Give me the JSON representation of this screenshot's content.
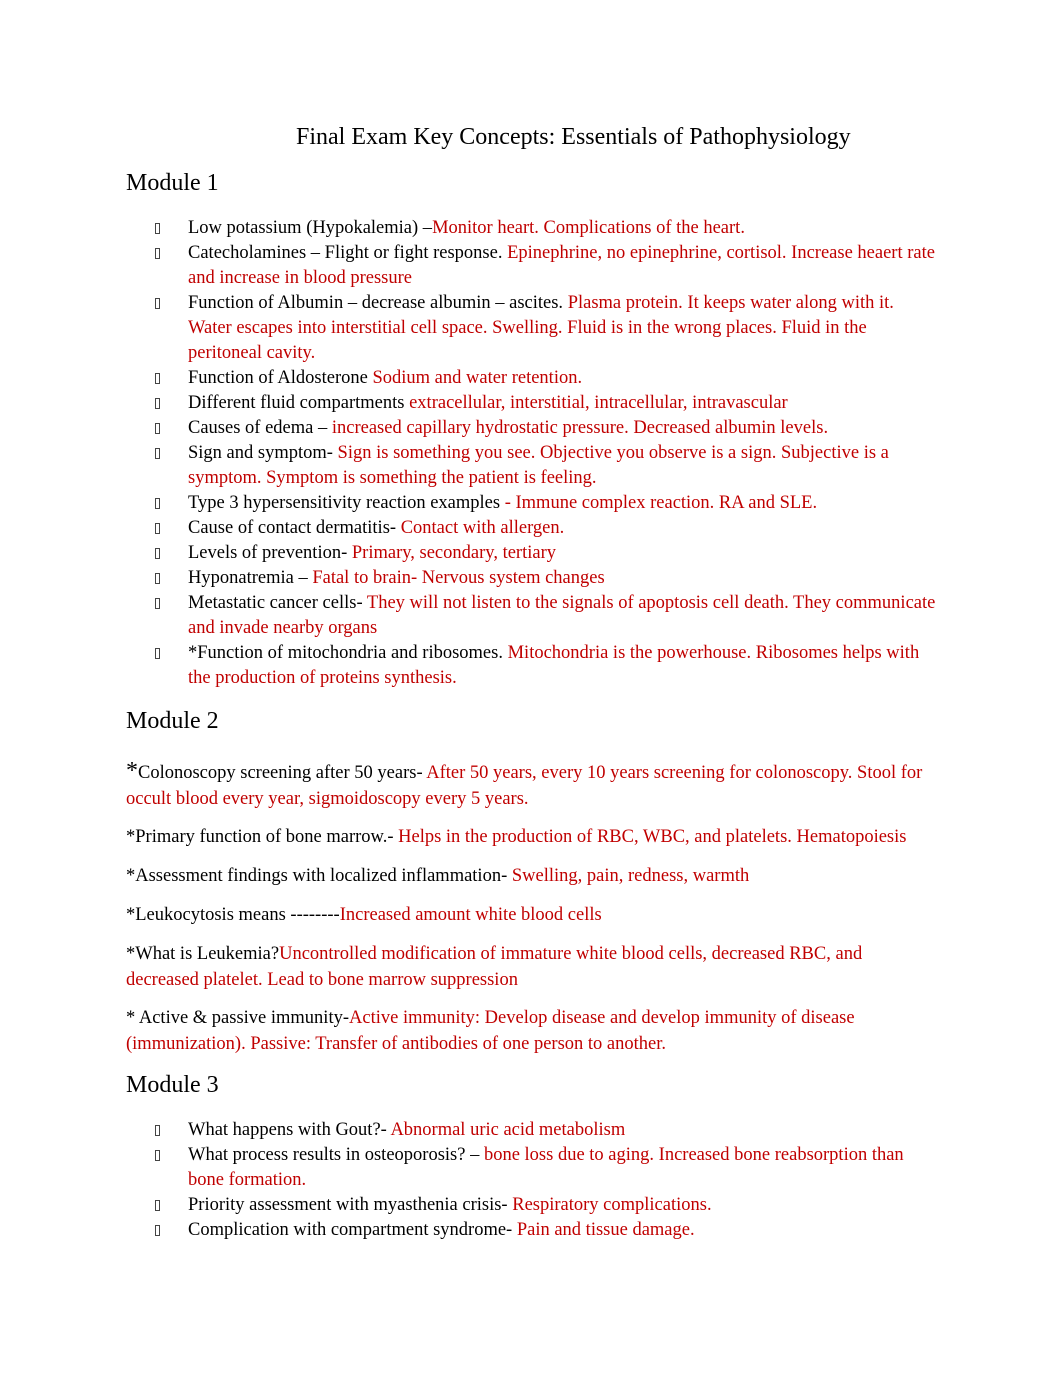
{
  "document": {
    "title": "Final Exam Key Concepts: Essentials of Pathophysiology",
    "text_color": "#000000",
    "answer_color": "#c00000"
  },
  "module1": {
    "heading": "Module 1",
    "items": [
      {
        "q": "Low potassium (Hypokalemia) –",
        "a": "Monitor heart. Complications of the heart."
      },
      {
        "q": "Catecholamines – Flight or fight response. ",
        "a": "Epinephrine, no epinephrine, cortisol. Increase heaert rate and increase in blood pressure"
      },
      {
        "q": "Function of Albumin – decrease albumin – ascites. ",
        "a": "Plasma protein. It keeps water along with it. Water escapes into interstitial cell space. Swelling. Fluid is in the wrong places. Fluid in the peritoneal cavity."
      },
      {
        "q": "Function of Aldosterone ",
        "a": "Sodium and water retention."
      },
      {
        "q": "Different fluid compartments  ",
        "a": "extracellular, interstitial, intracellular, intravascular"
      },
      {
        "q": "Causes of edema – ",
        "a": "increased capillary hydrostatic pressure. Decreased albumin levels."
      },
      {
        "q": "Sign and symptom- ",
        "a": "Sign is something you see. Objective you observe is a sign. Subjective is a symptom. Symptom is something the patient is feeling."
      },
      {
        "q": "Type 3 hypersensitivity reaction examples ",
        "a": "- Immune complex reaction. RA and SLE."
      },
      {
        "q": "Cause of contact dermatitis-  ",
        "a": "Contact with allergen."
      },
      {
        "q": "Levels of prevention- ",
        "a": "Primary, secondary, tertiary"
      },
      {
        "q": "Hyponatremia – ",
        "a": "Fatal to brain- Nervous system changes"
      },
      {
        "q": "Metastatic cancer cells- ",
        "a": "They will not listen to the signals of apoptosis cell death. They communicate and invade nearby organs"
      },
      {
        "q": "*Function of mitochondria and ribosomes.  ",
        "a": "Mitochondria is the powerhouse. Ribosomes helps with the production of proteins synthesis."
      }
    ]
  },
  "module2": {
    "heading": "Module 2",
    "items": [
      {
        "star": "*",
        "q": "Colonoscopy screening after 50 years- ",
        "a": "After 50 years, every 10 years screening for colonoscopy. Stool for occult blood every year, sigmoidoscopy every 5 years."
      },
      {
        "q": "*Primary function of bone marrow.-  ",
        "a": "Helps in the production of RBC, WBC, and platelets. Hematopoiesis"
      },
      {
        "q": "*Assessment findings with localized inflammation- ",
        "a": "Swelling, pain, redness, warmth"
      },
      {
        "q": "*Leukocytosis means --------",
        "a": "Increased amount white blood cells"
      },
      {
        "q": "*What is Leukemia?",
        "a": "Uncontrolled modification of immature white blood cells, decreased RBC, and decreased platelet. Lead to bone marrow suppression"
      },
      {
        "q": "* Active & passive immunity-",
        "a": "Active immunity: Develop disease and develop immunity of disease (immunization). Passive: Transfer of antibodies of one person to another."
      }
    ]
  },
  "module3": {
    "heading": "Module 3",
    "items": [
      {
        "q": "What happens with Gout?-  ",
        "a": "Abnormal uric acid metabolism"
      },
      {
        "q": "What process results in osteoporosis? –  ",
        "a": "bone loss due to aging. Increased bone reabsorption than bone formation."
      },
      {
        "q": "Priority assessment with myasthenia crisis-  ",
        "a": "Respiratory complications."
      },
      {
        "q": "Complication with compartment syndrome-  ",
        "a": "Pain and tissue damage."
      }
    ]
  }
}
